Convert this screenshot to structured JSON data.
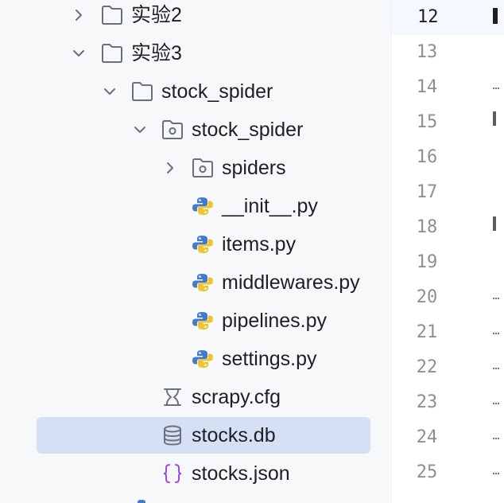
{
  "project_tree": {
    "items": [
      {
        "label": "实验2",
        "kind": "folder",
        "expanded": false
      },
      {
        "label": "实验3",
        "kind": "folder",
        "expanded": true
      },
      {
        "label": "stock_spider",
        "kind": "folder",
        "expanded": true
      },
      {
        "label": "stock_spider",
        "kind": "package",
        "expanded": true
      },
      {
        "label": "spiders",
        "kind": "package",
        "expanded": false
      },
      {
        "label": "__init__.py",
        "kind": "python"
      },
      {
        "label": "items.py",
        "kind": "python"
      },
      {
        "label": "middlewares.py",
        "kind": "python"
      },
      {
        "label": "pipelines.py",
        "kind": "python"
      },
      {
        "label": "settings.py",
        "kind": "python"
      },
      {
        "label": "scrapy.cfg",
        "kind": "config"
      },
      {
        "label": "stocks.db",
        "kind": "database",
        "selected": true
      },
      {
        "label": "stocks.json",
        "kind": "json"
      }
    ],
    "selection_color": "#d5e0f5"
  },
  "editor_gutter": {
    "current_line": "12",
    "line_numbers": [
      "12",
      "13",
      "14",
      "15",
      "16",
      "17",
      "18",
      "19",
      "20",
      "21",
      "22",
      "23",
      "24",
      "25"
    ]
  },
  "icons": {
    "folder": "folder-icon",
    "package": "package-folder-icon",
    "python": "python-file-icon",
    "config": "config-file-icon",
    "database": "database-icon",
    "json": "json-braces-icon",
    "chevron_right": "chevron-right-icon",
    "chevron_down": "chevron-down-icon"
  },
  "colors": {
    "python_blue": "#3f7bd3",
    "python_yellow": "#f2c331",
    "json_purple": "#9a4de0",
    "icon_gray": "#6c707e"
  }
}
